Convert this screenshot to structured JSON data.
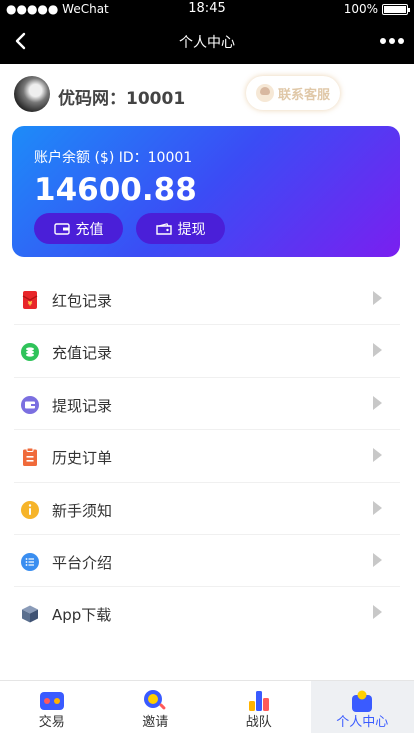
{
  "status_bar": {
    "carrier": "●●●●● WeChat",
    "time": "18:45",
    "battery": "100%"
  },
  "navbar": {
    "title": "个人中心"
  },
  "profile": {
    "username": "优码网：10001",
    "service_label": "联系客服"
  },
  "balance_card": {
    "label": "账户余额 ($) ID：10001",
    "amount": "14600.88",
    "recharge_label": "充值",
    "withdraw_label": "提现"
  },
  "menu": [
    {
      "label": "红包记录",
      "icon": "red-envelope-icon",
      "color": "#e8262a"
    },
    {
      "label": "充值记录",
      "icon": "coins-icon",
      "color": "#2fc35a"
    },
    {
      "label": "提现记录",
      "icon": "wallet-icon",
      "color": "#7b6fe0"
    },
    {
      "label": "历史订单",
      "icon": "clipboard-icon",
      "color": "#f06a3a"
    },
    {
      "label": "新手须知",
      "icon": "info-icon",
      "color": "#f6b42a"
    },
    {
      "label": "平台介绍",
      "icon": "list-icon",
      "color": "#3a8ef0"
    },
    {
      "label": "App下载",
      "icon": "cube-icon",
      "color": "#5a6f8e"
    }
  ],
  "tabbar": [
    {
      "label": "交易",
      "icon": "trade-icon"
    },
    {
      "label": "邀请",
      "icon": "invite-icon"
    },
    {
      "label": "战队",
      "icon": "team-icon"
    },
    {
      "label": "个人中心",
      "icon": "profile-icon",
      "active": true
    }
  ],
  "colors": {
    "accent": "#3a5bff",
    "card_start": "#1d8cf8",
    "card_end": "#7a1ff0"
  }
}
